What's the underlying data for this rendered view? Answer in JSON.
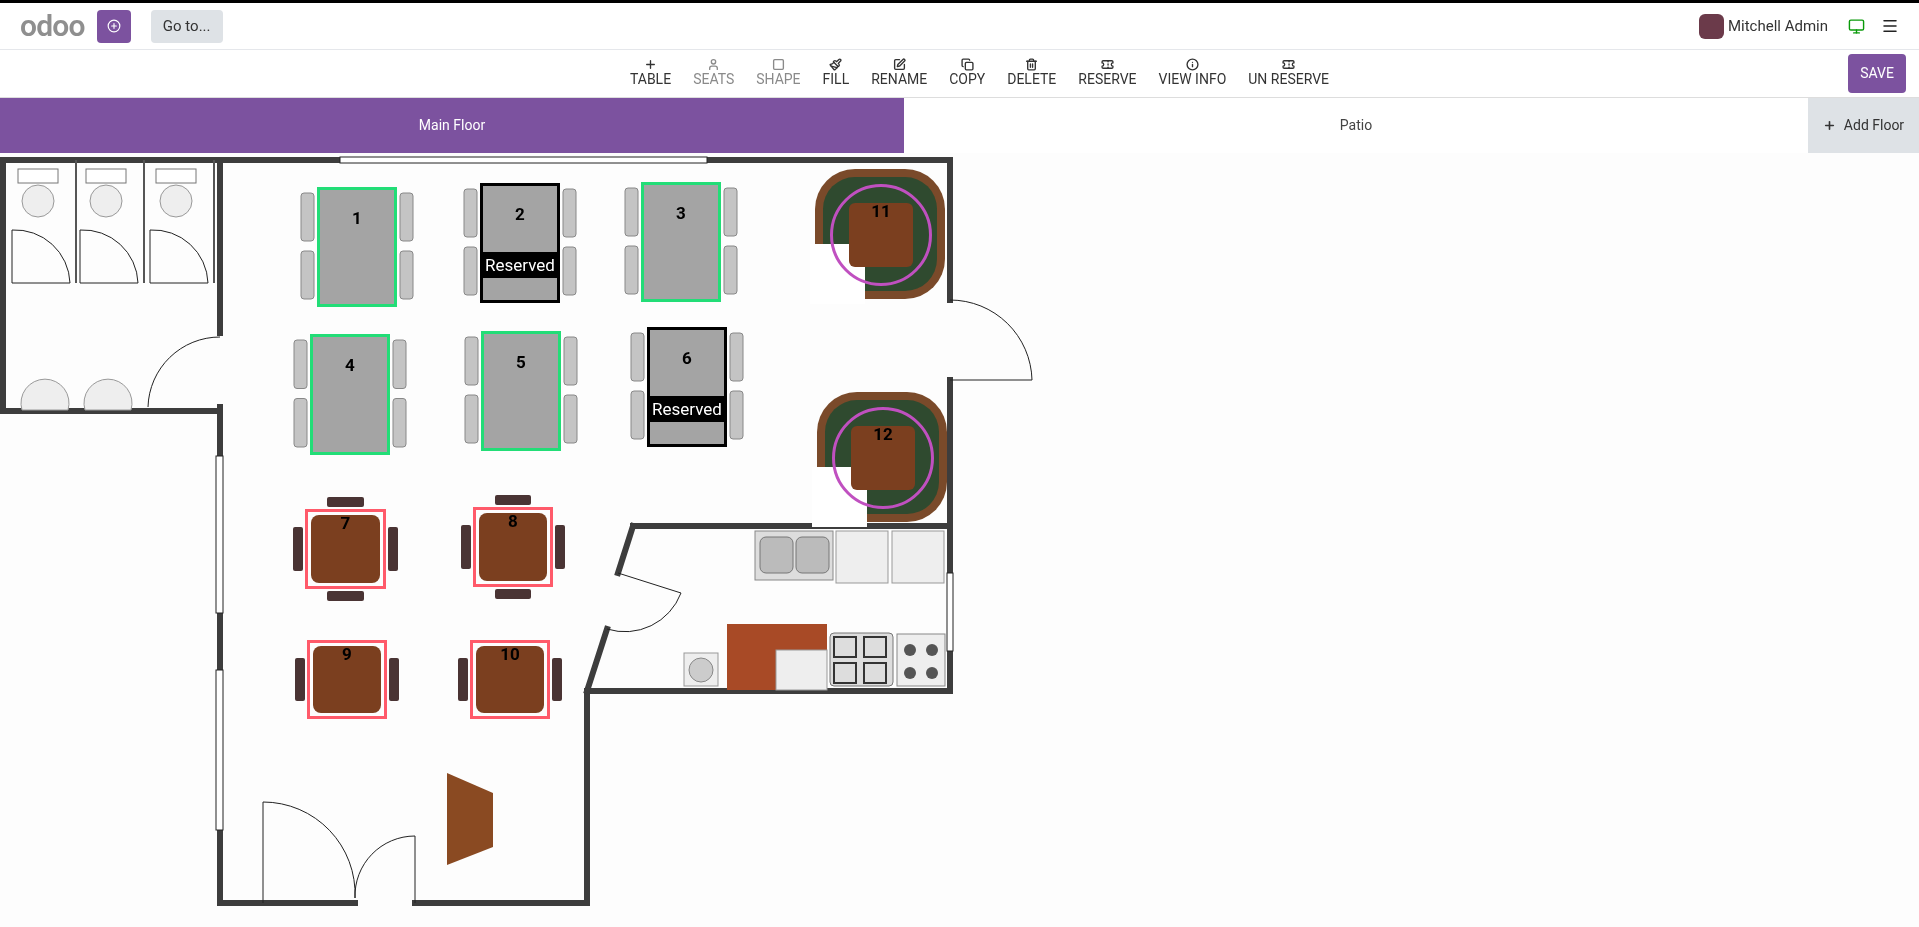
{
  "navbar": {
    "logo": "odoo",
    "goto_button": "Go to...",
    "user": "Mitchell Admin"
  },
  "toolbar": {
    "actions": [
      {
        "label": "TABLE",
        "kind": "plus",
        "disabled": false
      },
      {
        "label": "SEATS",
        "kind": "user",
        "disabled": true
      },
      {
        "label": "SHAPE",
        "kind": "square",
        "disabled": true
      },
      {
        "label": "FILL",
        "kind": "brush",
        "disabled": false
      },
      {
        "label": "RENAME",
        "kind": "edit",
        "disabled": false
      },
      {
        "label": "COPY",
        "kind": "copy",
        "disabled": false
      },
      {
        "label": "DELETE",
        "kind": "trash",
        "disabled": false
      },
      {
        "label": "RESERVE",
        "kind": "ticket",
        "disabled": false
      },
      {
        "label": "VIEW INFO",
        "kind": "info",
        "disabled": false
      },
      {
        "label": "UN RESERVE",
        "kind": "ticket",
        "disabled": false
      }
    ],
    "save_button": "SAVE"
  },
  "floor_tabs": [
    {
      "label": "Main Floor",
      "selected": true
    },
    {
      "label": "Patio",
      "selected": false
    }
  ],
  "add_floor_button": "Add Floor",
  "tables": [
    {
      "number": "1",
      "kind": "rect",
      "color": "#22dd77"
    },
    {
      "number": "2",
      "kind": "rect",
      "color": "#000000",
      "status": "Reserved"
    },
    {
      "number": "3",
      "kind": "rect",
      "color": "#22dd77"
    },
    {
      "number": "4",
      "kind": "rect",
      "color": "#22dd77"
    },
    {
      "number": "5",
      "kind": "rect",
      "color": "#22dd77"
    },
    {
      "number": "6",
      "kind": "rect",
      "color": "#000000",
      "status": "Reserved"
    },
    {
      "number": "7",
      "kind": "square",
      "color": "#ff5a6a"
    },
    {
      "number": "8",
      "kind": "square",
      "color": "#ff5a6a"
    },
    {
      "number": "9",
      "kind": "square",
      "color": "#ff5a6a"
    },
    {
      "number": "10",
      "kind": "square",
      "color": "#ff5a6a"
    },
    {
      "number": "11",
      "kind": "round",
      "color": "#c050c0"
    },
    {
      "number": "12",
      "kind": "round",
      "color": "#c050c0"
    }
  ]
}
